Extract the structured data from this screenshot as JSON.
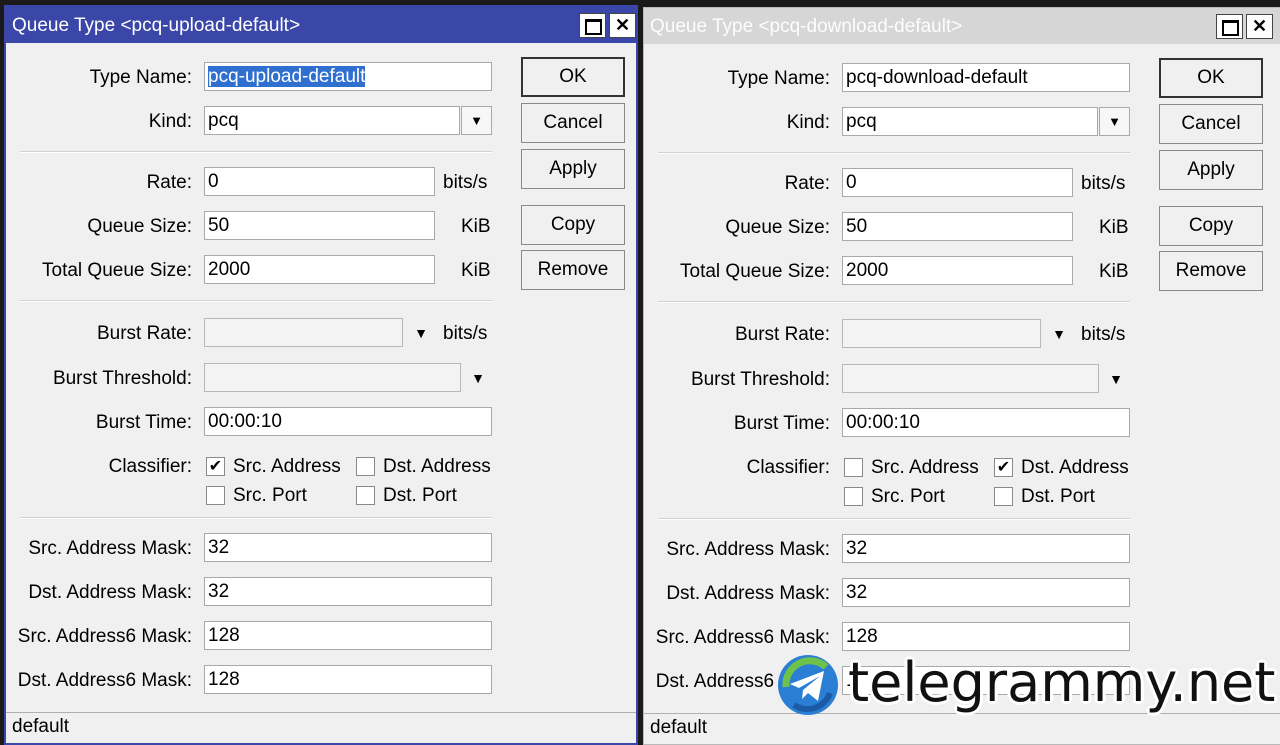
{
  "windows": [
    {
      "title": "Queue Type <pcq-upload-default>",
      "fields": {
        "type_name": {
          "label": "Type Name:",
          "value": "pcq-upload-default"
        },
        "kind": {
          "label": "Kind:",
          "value": "pcq"
        },
        "rate": {
          "label": "Rate:",
          "value": "0",
          "unit": "bits/s"
        },
        "queue_size": {
          "label": "Queue Size:",
          "value": "50",
          "unit": "KiB"
        },
        "total_queue_size": {
          "label": "Total Queue Size:",
          "value": "2000",
          "unit": "KiB"
        },
        "burst_rate": {
          "label": "Burst Rate:",
          "value": "",
          "unit": "bits/s"
        },
        "burst_threshold": {
          "label": "Burst Threshold:",
          "value": ""
        },
        "burst_time": {
          "label": "Burst Time:",
          "value": "00:00:10"
        },
        "classifier": {
          "label": "Classifier:",
          "src_address": {
            "label": "Src. Address",
            "checked": true
          },
          "dst_address": {
            "label": "Dst. Address",
            "checked": false
          },
          "src_port": {
            "label": "Src. Port",
            "checked": false
          },
          "dst_port": {
            "label": "Dst. Port",
            "checked": false
          }
        },
        "src_address_mask": {
          "label": "Src. Address Mask:",
          "value": "32"
        },
        "dst_address_mask": {
          "label": "Dst. Address Mask:",
          "value": "32"
        },
        "src_address6_mask": {
          "label": "Src. Address6 Mask:",
          "value": "128"
        },
        "dst_address6_mask": {
          "label": "Dst. Address6 Mask:",
          "value": "128"
        }
      },
      "buttons": {
        "ok": "OK",
        "cancel": "Cancel",
        "apply": "Apply",
        "copy": "Copy",
        "remove": "Remove"
      },
      "status": "default"
    },
    {
      "title": "Queue Type <pcq-download-default>",
      "fields": {
        "type_name": {
          "label": "Type Name:",
          "value": "pcq-download-default"
        },
        "kind": {
          "label": "Kind:",
          "value": "pcq"
        },
        "rate": {
          "label": "Rate:",
          "value": "0",
          "unit": "bits/s"
        },
        "queue_size": {
          "label": "Queue Size:",
          "value": "50",
          "unit": "KiB"
        },
        "total_queue_size": {
          "label": "Total Queue Size:",
          "value": "2000",
          "unit": "KiB"
        },
        "burst_rate": {
          "label": "Burst Rate:",
          "value": "",
          "unit": "bits/s"
        },
        "burst_threshold": {
          "label": "Burst Threshold:",
          "value": ""
        },
        "burst_time": {
          "label": "Burst Time:",
          "value": "00:00:10"
        },
        "classifier": {
          "label": "Classifier:",
          "src_address": {
            "label": "Src. Address",
            "checked": false
          },
          "dst_address": {
            "label": "Dst. Address",
            "checked": true
          },
          "src_port": {
            "label": "Src. Port",
            "checked": false
          },
          "dst_port": {
            "label": "Dst. Port",
            "checked": false
          }
        },
        "src_address_mask": {
          "label": "Src. Address Mask:",
          "value": "32"
        },
        "dst_address_mask": {
          "label": "Dst. Address Mask:",
          "value": "32"
        },
        "src_address6_mask": {
          "label": "Src. Address6 Mask:",
          "value": "128"
        },
        "dst_address6_mask": {
          "label": "Dst. Address6 Mask:",
          "value": "1"
        }
      },
      "buttons": {
        "ok": "OK",
        "cancel": "Cancel",
        "apply": "Apply",
        "copy": "Copy",
        "remove": "Remove"
      },
      "status": "default"
    }
  ],
  "icons": {
    "maximize": "maximize-icon",
    "close": "close-icon",
    "dropdown": "dropdown-arrow-icon",
    "check": "checkmark-icon",
    "watermark_logo": "telegram-logo-icon"
  },
  "colors": {
    "active_title": "#3a46a8",
    "inactive_title": "#d6d6d6",
    "selection": "#2f6fd0"
  },
  "watermark": {
    "text": "telegrammy.net"
  }
}
